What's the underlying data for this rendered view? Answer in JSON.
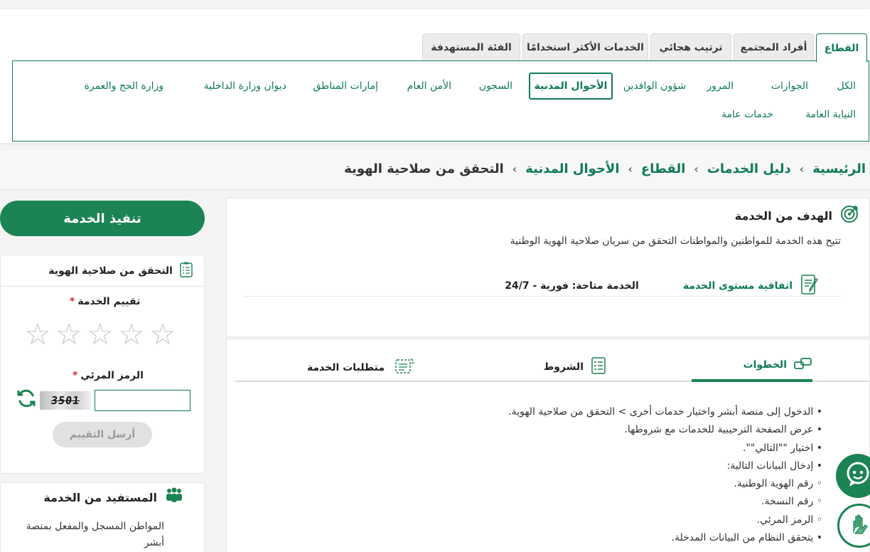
{
  "filter": {
    "tabs": [
      {
        "label": "القطاع",
        "active": true
      },
      {
        "label": "أفراد المجتمع",
        "active": false
      },
      {
        "label": "ترتيب هجائي",
        "active": false
      },
      {
        "label": "الخدمات الأكثر استخدامًا",
        "active": false
      },
      {
        "label": "الفئة المستهدفة",
        "active": false
      }
    ],
    "sectors_row1": [
      "الكل",
      "الجوازات",
      "المرور",
      "شؤون الوافدين",
      "الأحوال المدنية",
      "السجون",
      "الأمن العام",
      "إمارات المناطق",
      "ديوان وزارة الداخلية",
      "وزارة الحج والعمرة"
    ],
    "sectors_row2": [
      "النيابة العامة",
      "خدمات عامة"
    ],
    "active_sector": "الأحوال المدنية"
  },
  "breadcrumb": {
    "items": [
      "الرئيسية",
      "دليل الخدمات",
      "القطاع",
      "الأحوال المدنية"
    ],
    "current": "التحقق من صلاحية الهوية",
    "separator": "›"
  },
  "sidebar": {
    "execute_label": "تنفيذ الخدمة",
    "rating_card_title": "التحقق من صلاحية الهوية",
    "rating_label": "تقييم الخدمة",
    "required_mark": "*",
    "stars_total": 5,
    "stars_filled": 0,
    "captcha_label": "الرمز المرئي",
    "captcha_text": "3501",
    "send_label": "أرسل التقييم",
    "beneficiary_title": "المستفيد من الخدمة",
    "beneficiary_text": "المواطن المسجل والمفعل بمنصة أبشر"
  },
  "goal": {
    "title": "الهدف من الخدمة",
    "text": "تتيح هذه الخدمة للمواطنين والمواطنات التحقق من سريان صلاحية الهوية الوطنية",
    "sla_label": "اتفاقية مستوى الخدمة",
    "sla_value": "الخدمة متاحة: فورية - 24/7"
  },
  "details": {
    "tabs": [
      {
        "label": "الخطوات",
        "active": true
      },
      {
        "label": "الشروط",
        "active": false
      },
      {
        "label": "متطلبات الخدمة",
        "active": false
      }
    ],
    "steps": [
      {
        "text": "الدخول إلى منصة أبشر واختيار خدمات أخرى > التحقق من صلاحية الهوية.",
        "sub": false
      },
      {
        "text": "عرض الصفحة الترحيبية للخدمات مع شروطها.",
        "sub": false
      },
      {
        "text": "اختيار \"\"التالي\"\".",
        "sub": false
      },
      {
        "text": "إدخال البيانات التالية:",
        "sub": false
      },
      {
        "text": "رقم الهوية الوطنية.",
        "sub": true
      },
      {
        "text": "رقم النسخة.",
        "sub": true
      },
      {
        "text": "الرمز المرئي.",
        "sub": true
      },
      {
        "text": "يتحقق النظام من البيانات المدخلة.",
        "sub": false
      }
    ]
  },
  "colors": {
    "brand_green": "#1b8354",
    "link_green": "#0f7a5a",
    "required_red": "#d32f2f",
    "star_empty": "#c9c9c9"
  },
  "icons": {
    "goal": "target-icon",
    "sla": "contract-pen-icon",
    "rating_card": "checklist-icon",
    "beneficiary": "people-group-icon",
    "refresh": "refresh-icon",
    "steps_tab": "steps-icon",
    "conditions_tab": "checklist-icon",
    "requirements_tab": "requirements-icon",
    "chat": "chatbot-icon",
    "sign_language": "sign-language-icon"
  }
}
